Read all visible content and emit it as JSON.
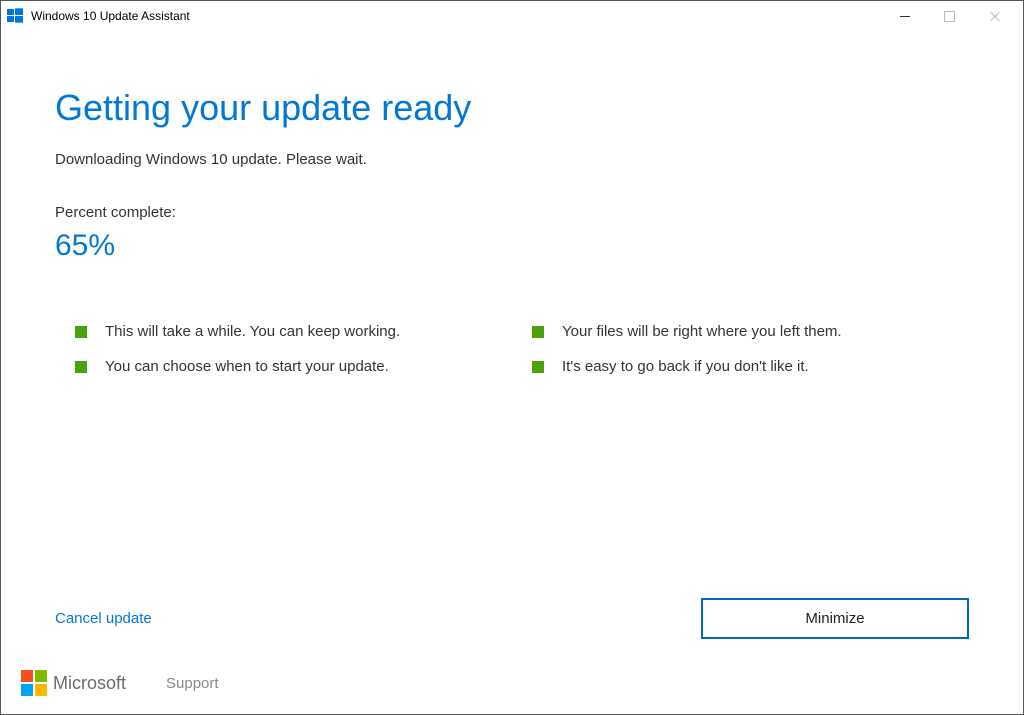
{
  "window": {
    "title": "Windows 10 Update Assistant"
  },
  "main": {
    "heading": "Getting your update ready",
    "subtitle": "Downloading Windows 10 update. Please wait.",
    "percent_label": "Percent complete:",
    "percent_value": "65%"
  },
  "bullets": {
    "top_left": "This will take a while. You can keep working.",
    "top_right": "Your files will be right where you left them.",
    "bottom_left": "You can choose when to start your update.",
    "bottom_right": "It's easy to go back if you don't like it."
  },
  "actions": {
    "cancel": "Cancel update",
    "minimize": "Minimize"
  },
  "footer": {
    "brand": "Microsoft",
    "support": "Support"
  }
}
